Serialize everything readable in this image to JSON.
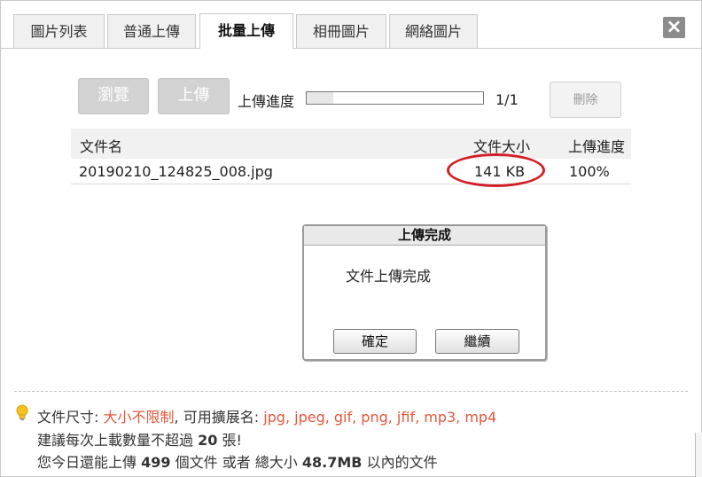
{
  "tabs": [
    {
      "label": "圖片列表"
    },
    {
      "label": "普通上傳"
    },
    {
      "label": "批量上傳"
    },
    {
      "label": "相冊圖片"
    },
    {
      "label": "網絡圖片"
    }
  ],
  "close_glyph": "×",
  "toolbar": {
    "browse_label": "瀏覽",
    "upload_label": "上傳",
    "progress_label": "上傳進度",
    "progress_count": "1/1",
    "progress_fraction": 0.15,
    "delete_label": "刪除"
  },
  "table": {
    "headers": {
      "name": "文件名",
      "size": "文件大小",
      "progress": "上傳進度"
    },
    "rows": [
      {
        "name": "20190210_124825_008.jpg",
        "size": "141 KB",
        "progress": "100%"
      }
    ]
  },
  "dialog": {
    "title": "上傳完成",
    "message": "文件上傳完成",
    "ok_label": "確定",
    "continue_label": "繼續"
  },
  "info": {
    "line1_prefix": "文件尺寸:",
    "line1_size": "大小不限制",
    "line1_mid": ", 可用擴展名:",
    "line1_ext": "jpg, jpeg, gif, png, jfif, mp3, mp4",
    "line2_prefix": "建議每次上載數量不超過",
    "line2_count": "20",
    "line2_suffix": "張!",
    "line3_prefix": "您今日還能上傳",
    "line3_count": "499",
    "line3_mid": "個文件 或者 總大小",
    "line3_size": "48.7MB",
    "line3_suffix": "以內的文件"
  },
  "colors": {
    "accent_red": "#e4573b",
    "annotation_oval": "#d32027"
  }
}
